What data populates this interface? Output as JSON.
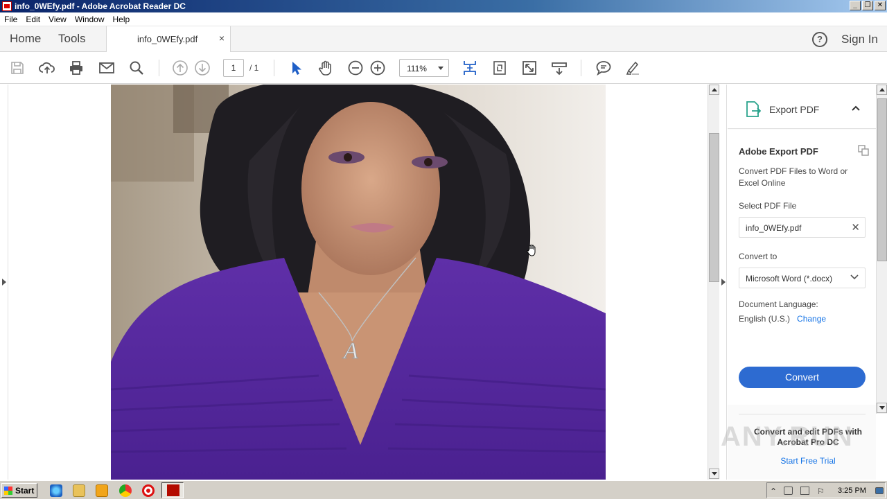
{
  "window": {
    "title": "info_0WEfy.pdf - Adobe Acrobat Reader DC",
    "buttons": [
      "_",
      "❐",
      "✕"
    ]
  },
  "menu": [
    "File",
    "Edit",
    "View",
    "Window",
    "Help"
  ],
  "tabs": {
    "home": "Home",
    "tools": "Tools",
    "document": "info_0WEfy.pdf",
    "close": "×",
    "help": "?",
    "sign_in": "Sign In"
  },
  "toolbar": {
    "icons": [
      "save-icon",
      "upload-icon",
      "print-icon",
      "email-icon",
      "search-icon",
      "prev-page-icon",
      "next-page-icon",
      "select-cursor-icon",
      "hand-icon",
      "zoom-out-icon",
      "zoom-in-icon",
      "fit-page-icon",
      "rotate-icon",
      "full-screen-icon",
      "read-mode-icon",
      "comment-icon",
      "highlight-icon"
    ],
    "page_current": "1",
    "page_total": "/ 1",
    "zoom": "111%"
  },
  "export_pane": {
    "header": "Export PDF",
    "title": "Adobe Export PDF",
    "description": "Convert PDF Files to Word or Excel Online",
    "select_label": "Select PDF File",
    "selected_file": "info_0WEfy.pdf",
    "convert_to_label": "Convert to",
    "convert_to_value": "Microsoft Word (*.docx)",
    "language_label": "Document Language:",
    "language_value": "English (U.S.)",
    "change_link": "Change",
    "convert_button": "Convert",
    "promo": "Convert and edit PDFs with Acrobat Pro DC",
    "trial_link": "Start Free Trial"
  },
  "taskbar": {
    "start": "Start",
    "time": "3:25 PM"
  },
  "watermark": "ANY.RUN",
  "colors": {
    "accent": "#2d6bd1",
    "link": "#1473e6",
    "sweater": "#5a2a9e"
  }
}
